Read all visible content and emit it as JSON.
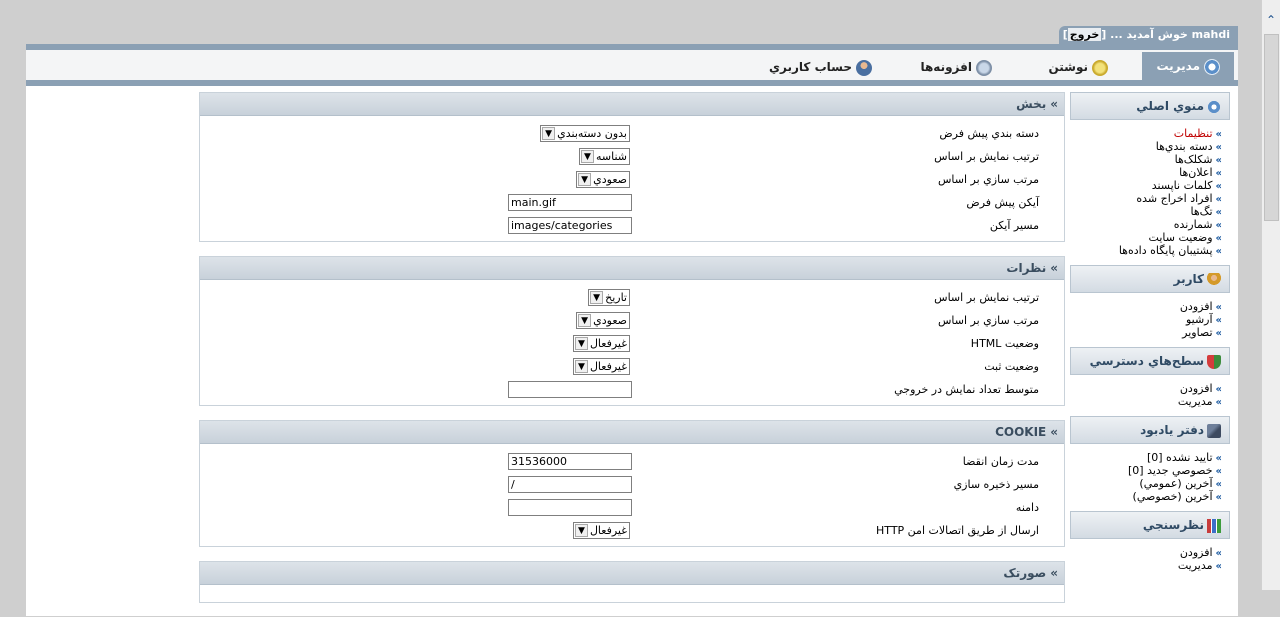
{
  "userbar": {
    "username": "mahdi",
    "welcome": "خوش آمدید ...",
    "logout": "خروج"
  },
  "tabs": [
    {
      "label": "مديريت",
      "icon": "gear-icon"
    },
    {
      "label": "نوشتن",
      "icon": "pen-icon"
    },
    {
      "label": "افزونه‌ها",
      "icon": "plugin-icon"
    },
    {
      "label": "حساب کاربري",
      "icon": "user-icon"
    }
  ],
  "sections": {
    "section1": {
      "title": "بخش",
      "rows": [
        {
          "label": "دسته بندي پيش فرض",
          "value": "بدون دسته‌بندي"
        },
        {
          "label": "ترتيب نمايش بر اساس",
          "value": "شناسه"
        },
        {
          "label": "مرتب سازي بر اساس",
          "value": "صعودي"
        },
        {
          "label": "آيکن پيش فرض",
          "value": "main.gif"
        },
        {
          "label": "مسير آيکن",
          "value": "images/categories"
        }
      ]
    },
    "section2": {
      "title": "نظرات",
      "rows": [
        {
          "label": "ترتيب نمايش بر اساس",
          "value": "تاريخ"
        },
        {
          "label": "مرتب سازي بر اساس",
          "value": "صعودي"
        },
        {
          "label": "وضعيت HTML",
          "value": "غيرفعال"
        },
        {
          "label": "وضعيت ثبت",
          "value": "غيرفعال"
        },
        {
          "label": "متوسط تعداد نمايش در خروجي",
          "value": ""
        }
      ]
    },
    "section3": {
      "title": "COOKIE",
      "rows": [
        {
          "label": "مدت زمان انقضا",
          "value": "31536000"
        },
        {
          "label": "مسير ذخيره سازي",
          "value": "/"
        },
        {
          "label": "دامنه",
          "value": ""
        },
        {
          "label": "ارسال از طريق اتصالات امن HTTP",
          "value": "غيرفعال"
        }
      ]
    },
    "section4": {
      "title": "صورتک"
    }
  },
  "sidebar": {
    "main_menu": {
      "title": "منوي اصلي",
      "items": [
        "تنظيمات",
        "دسته بندي‌ها",
        "شکلک‌ها",
        "اعلان‌ها",
        "کلمات ناپسند",
        "افراد اخراج شده",
        "تگ‌ها",
        "شمارنده",
        "وضعيت سايت",
        "پشتيبان پايگاه داده‌ها"
      ]
    },
    "user": {
      "title": "کاربر",
      "items": [
        "افزودن",
        "آرشيو",
        "تصاوير"
      ]
    },
    "access": {
      "title": "سطح‌هاي دسترسي",
      "items": [
        "افزودن",
        "مديريت"
      ]
    },
    "guestbook": {
      "title": "دفتر يادبود",
      "items": [
        "تاييد نشده [0]",
        "خصوصي جديد [0]",
        "آخرين (عمومي)",
        "آخرين (خصوصي)"
      ]
    },
    "poll": {
      "title": "نظرسنجي",
      "items": [
        "افزودن",
        "مديريت"
      ]
    }
  },
  "colors": {
    "accent": "#8ba0b4",
    "link": "#1c5aa0",
    "active": "#c00000"
  }
}
